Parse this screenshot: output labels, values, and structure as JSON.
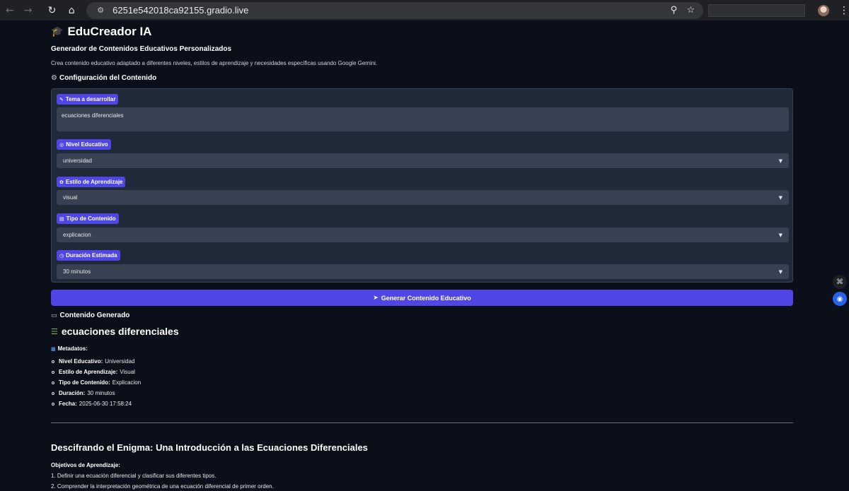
{
  "browser": {
    "url": "6251e542018ca92155.gradio.live"
  },
  "app": {
    "title": "EduCreador IA",
    "subtitle": "Generador de Contenidos Educativos Personalizados",
    "description": "Crea contenido educativo adaptado a diferentes niveles, estilos de aprendizaje y necesidades específicas usando Google Gemini."
  },
  "config": {
    "title": "Configuración del Contenido",
    "fields": [
      {
        "label": "Tema a desarrollar",
        "value": "ecuaciones diferenciales",
        "icon": "memo-icon"
      },
      {
        "label": "Nivel Educativo",
        "value": "universidad",
        "icon": "target-icon"
      },
      {
        "label": "Estilo de Aprendizaje",
        "value": "visual",
        "icon": "brain-icon"
      },
      {
        "label": "Tipo de Contenido",
        "value": "explicacion",
        "icon": "clipboard-icon"
      },
      {
        "label": "Duración Estimada",
        "value": "30 minutos",
        "icon": "clock-icon"
      }
    ]
  },
  "generate_button": "Generar Contenido Educativo",
  "output": {
    "section_title": "Contenido Generado",
    "topic": "ecuaciones diferenciales",
    "metadata_title": "Metadatos:",
    "metadata": [
      {
        "key": "Nivel Educativo:",
        "value": "Universidad"
      },
      {
        "key": "Estilo de Aprendizaje:",
        "value": "Visual"
      },
      {
        "key": "Tipo de Contenido:",
        "value": "Explicacion"
      },
      {
        "key": "Duración:",
        "value": "30 minutos"
      },
      {
        "key": "Fecha:",
        "value": "2025-06-30 17:58:24"
      }
    ],
    "article_title": "Descifrando el Enigma: Una Introducción a las Ecuaciones Diferenciales",
    "objectives_title": "Objetivos de Aprendizaje:",
    "objectives": [
      "1. Definir una ecuación diferencial y clasificar sus diferentes tipos.",
      "2. Comprender la interpretación geométrica de una ecuación diferencial de primer orden."
    ]
  },
  "colors": {
    "background": "#0b0f19",
    "panel": "#1f2937",
    "input": "#374151",
    "accent": "#4f46e5"
  }
}
